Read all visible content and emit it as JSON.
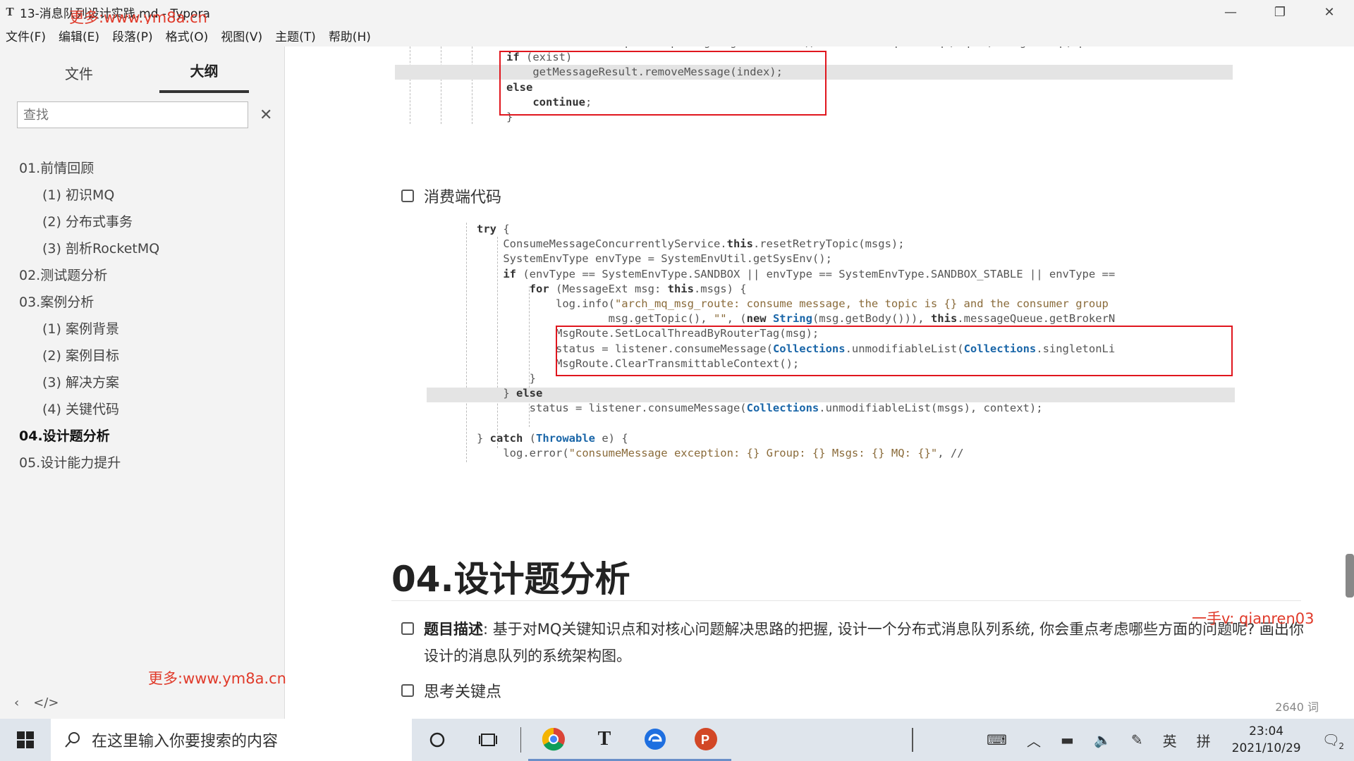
{
  "window": {
    "app_icon": "T",
    "title": "13-消息队列设计实践.md - Typora",
    "minimize": "—",
    "maximize": "❐",
    "close": "✕"
  },
  "watermarks": {
    "top": "更多:www.ym8a.cn",
    "sidebar": "更多:www.ym8a.cn",
    "right": "一手v: qianren03"
  },
  "menu": [
    "文件(F)",
    "编辑(E)",
    "段落(P)",
    "格式(O)",
    "视图(V)",
    "主题(T)",
    "帮助(H)"
  ],
  "sidebar": {
    "tabs": [
      {
        "label": "文件"
      },
      {
        "label": "大纲"
      }
    ],
    "search_placeholder": "查找",
    "clear": "✕",
    "outline": [
      {
        "label": "01.前情回顾",
        "level": 1
      },
      {
        "label": "(1) 初识MQ",
        "level": 2
      },
      {
        "label": "(2) 分布式事务",
        "level": 2
      },
      {
        "label": "(3) 剖析RocketMQ",
        "level": 2
      },
      {
        "label": "02.测试题分析",
        "level": 1
      },
      {
        "label": "03.案例分析",
        "level": 1
      },
      {
        "label": "(1) 案例背景",
        "level": 2
      },
      {
        "label": "(2) 案例目标",
        "level": 2
      },
      {
        "label": "(3) 解决方案",
        "level": 2
      },
      {
        "label": "(4) 关键代码",
        "level": 2
      },
      {
        "label": "04.设计题分析",
        "level": 1,
        "active": true
      },
      {
        "label": "05.设计能力提升",
        "level": 1
      }
    ],
    "footer_back": "‹",
    "footer_source": "</>"
  },
  "code_top": [
    "Boolean exist = TopicGroupManager.getInstance().existsDevTopicGroup(topic, originalIp, pullGrou",
    "if (exist)",
    "    getMessageResult.removeMessage(index);",
    "else",
    "    continue;",
    "}"
  ],
  "task_consumer": "消费端代码",
  "code_main": [
    "try {",
    "    ConsumeMessageConcurrentlyService.this.resetRetryTopic(msgs);",
    "    SystemEnvType envType = SystemEnvUtil.getSysEnv();",
    "    if (envType == SystemEnvType.SANDBOX || envType == SystemEnvType.SANDBOX_STABLE || envType ==",
    "        for (MessageExt msg: this.msgs) {",
    "            log.info(\"arch_mq_msg_route: consume message, the topic is {} and the consumer group",
    "                    msg.getTopic(), \"\", (new String(msg.getBody())), this.messageQueue.getBrokerN",
    "            MsgRoute.SetLocalThreadByRouterTag(msg);",
    "            status = listener.consumeMessage(Collections.unmodifiableList(Collections.singletonLi",
    "            MsgRoute.ClearTransmittableContext();",
    "        }",
    "    } else  ",
    "        status = listener.consumeMessage(Collections.unmodifiableList(msgs), context);",
    "    ",
    "} catch (Throwable e) {",
    "    log.error(\"consumeMessage exception: {} Group: {} Msgs: {} MQ: {}\", //"
  ],
  "heading": "04.设计题分析",
  "task_description": {
    "label": "题目描述",
    "text": ": 基于对MQ关键知识点和对核心问题解决思路的把握, 设计一个分布式消息队列系统, 你会重点考虑哪些方面的问题呢? 画出你设计的消息队列的系统架构图。"
  },
  "task_key_points": "思考关键点",
  "word_count": "2640 词",
  "taskbar": {
    "search_placeholder": "在这里输入你要搜索的内容",
    "apps": [
      "cortana-icon",
      "task-view-icon",
      "chrome-icon",
      "typora-icon",
      "browser-icon",
      "powerpoint-icon"
    ],
    "typora_letter": "T",
    "powerpoint_letter": "P",
    "ime_lang": "英",
    "ime_mode": "拼",
    "time": "23:04",
    "date": "2021/10/29",
    "notification_count": "2"
  },
  "colors": {
    "accent_red": "#e0161e",
    "watermark_red": "#e03a2a",
    "keyword_blue": "#1a66a8"
  }
}
